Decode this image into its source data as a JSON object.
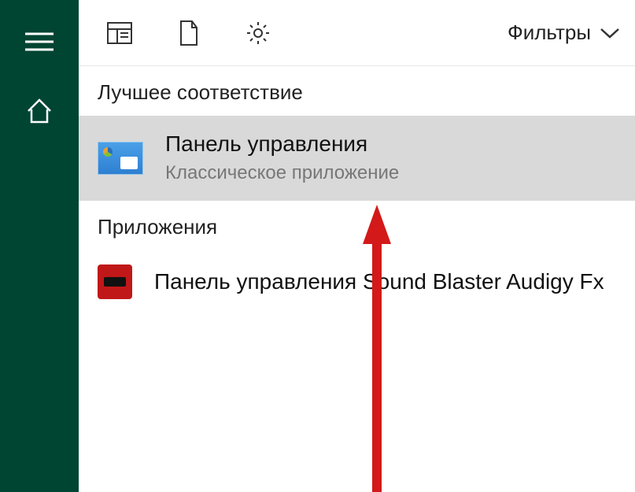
{
  "toolbar": {
    "filters_label": "Фильтры"
  },
  "sections": {
    "best_match": "Лучшее соответствие",
    "apps": "Приложения"
  },
  "results": {
    "best": {
      "title": "Панель управления",
      "subtitle": "Классическое приложение"
    },
    "app1": {
      "title": "Панель управления Sound Blaster Audigy Fx"
    }
  }
}
